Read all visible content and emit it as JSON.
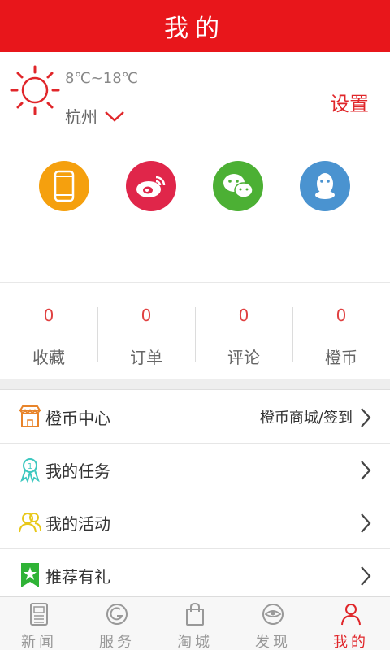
{
  "header": {
    "title": "我的"
  },
  "weather": {
    "temperature": "8℃~18℃",
    "city": "杭州",
    "icon": "sun-icon"
  },
  "settings_label": "设置",
  "socials": [
    {
      "name": "phone",
      "icon": "phone-icon",
      "color": "#f5a00e"
    },
    {
      "name": "weibo",
      "icon": "weibo-icon",
      "color": "#e0264a"
    },
    {
      "name": "wechat",
      "icon": "wechat-icon",
      "color": "#4cb034"
    },
    {
      "name": "qq",
      "icon": "qq-icon",
      "color": "#4a93d0"
    }
  ],
  "stats": [
    {
      "value": "0",
      "label": "收藏"
    },
    {
      "value": "0",
      "label": "订单"
    },
    {
      "value": "0",
      "label": "评论"
    },
    {
      "value": "0",
      "label": "橙币"
    }
  ],
  "menu": [
    {
      "label": "橙币中心",
      "extra": "橙币商城/签到",
      "icon": "shop-icon"
    },
    {
      "label": "我的任务",
      "extra": "",
      "icon": "medal-icon"
    },
    {
      "label": "我的活动",
      "extra": "",
      "icon": "people-icon"
    },
    {
      "label": "推荐有礼",
      "extra": "",
      "icon": "bookmark-star-icon"
    }
  ],
  "tabs": [
    {
      "label": "新闻",
      "icon": "newspaper-icon",
      "active": false
    },
    {
      "label": "服务",
      "icon": "service-icon",
      "active": false
    },
    {
      "label": "淘城",
      "icon": "shopping-bag-icon",
      "active": false
    },
    {
      "label": "发现",
      "icon": "eye-icon",
      "active": false
    },
    {
      "label": "我的",
      "icon": "person-icon",
      "active": true
    }
  ],
  "colors": {
    "brand_red": "#e8161b",
    "accent_red": "#e0262a"
  }
}
